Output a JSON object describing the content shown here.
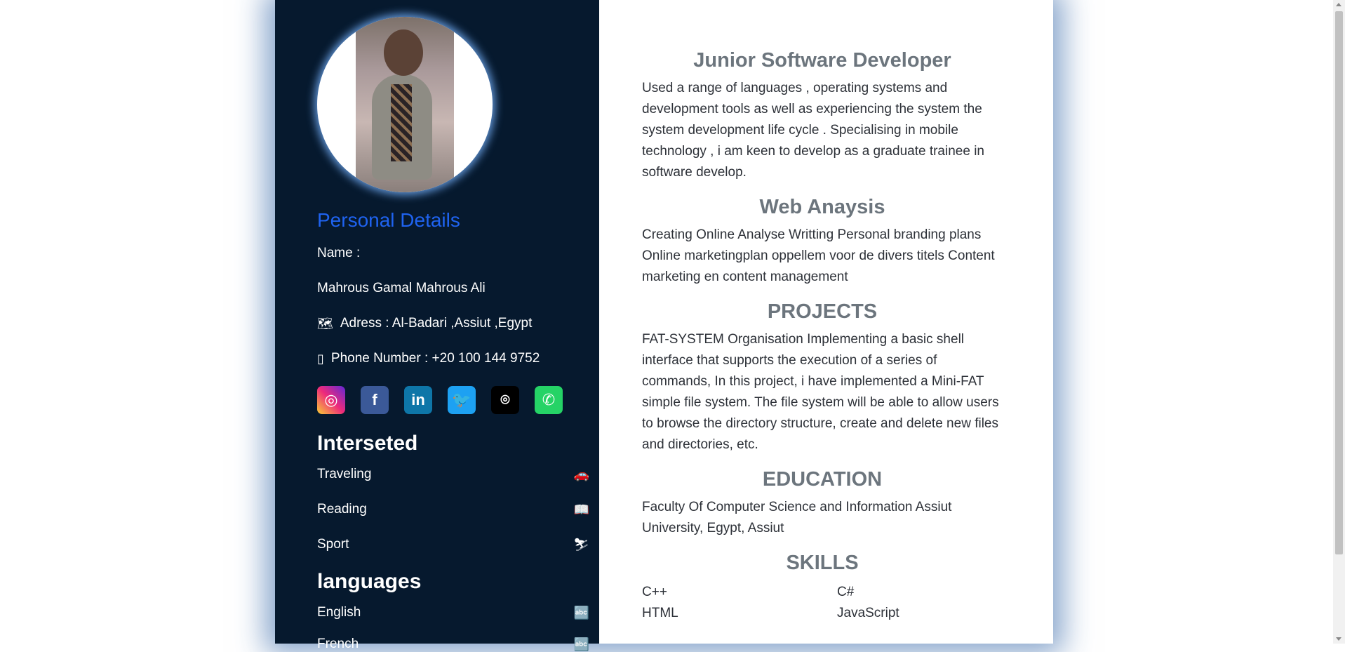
{
  "sidebar": {
    "title": "Personal Details",
    "name_label": "Name :",
    "name_value": "Mahrous Gamal Mahrous Ali",
    "address": "Adress : Al-Badari ,Assiut ,Egypt",
    "phone": "Phone Number : +20 100 144 9752",
    "social": [
      {
        "name": "instagram-icon",
        "glyph": "◎",
        "color": "#e1306c"
      },
      {
        "name": "facebook-icon",
        "glyph": "f",
        "color": "#3b5998"
      },
      {
        "name": "linkedin-icon",
        "glyph": "in",
        "color": "#0e76a8"
      },
      {
        "name": "twitter-icon",
        "glyph": "🐦",
        "color": "#1da1f2"
      },
      {
        "name": "github-icon",
        "glyph": "⌾",
        "color": "#000000"
      },
      {
        "name": "whatsapp-icon",
        "glyph": "✆",
        "color": "#25d366"
      }
    ],
    "interests_heading": "Interseted",
    "interests": [
      "Traveling",
      "Reading",
      "Sport"
    ],
    "languages_heading": "languages",
    "languages": [
      "English",
      "French"
    ]
  },
  "main": {
    "job_title": "Junior Software Developer",
    "job_desc": "Used a range of languages , operating systems and development tools as well as experiencing the system the system development life cycle . Specialising in mobile technology , i am keen to develop as a graduate trainee in software develop.",
    "web_title": "Web Anaysis",
    "web_desc": "Creating Online Analyse Writting Personal branding plans Online marketingplan oppellem voor de divers titels Content marketing en content management",
    "projects_title": "PROJECTS",
    "projects_desc": "FAT-SYSTEM Organisation Implementing a basic shell interface that supports the execution of a series of commands, In this project, i have implemented a Mini-FAT simple file system. The file system will be able to allow users to browse the directory structure, create and delete new files and directories, etc.",
    "education_title": "EDUCATION",
    "education_desc": "Faculty Of Computer Science and Information Assiut University, Egypt, Assiut",
    "skills_title": "SKILLS",
    "skills": [
      "C++",
      "C#",
      "HTML",
      "JavaScript"
    ]
  }
}
